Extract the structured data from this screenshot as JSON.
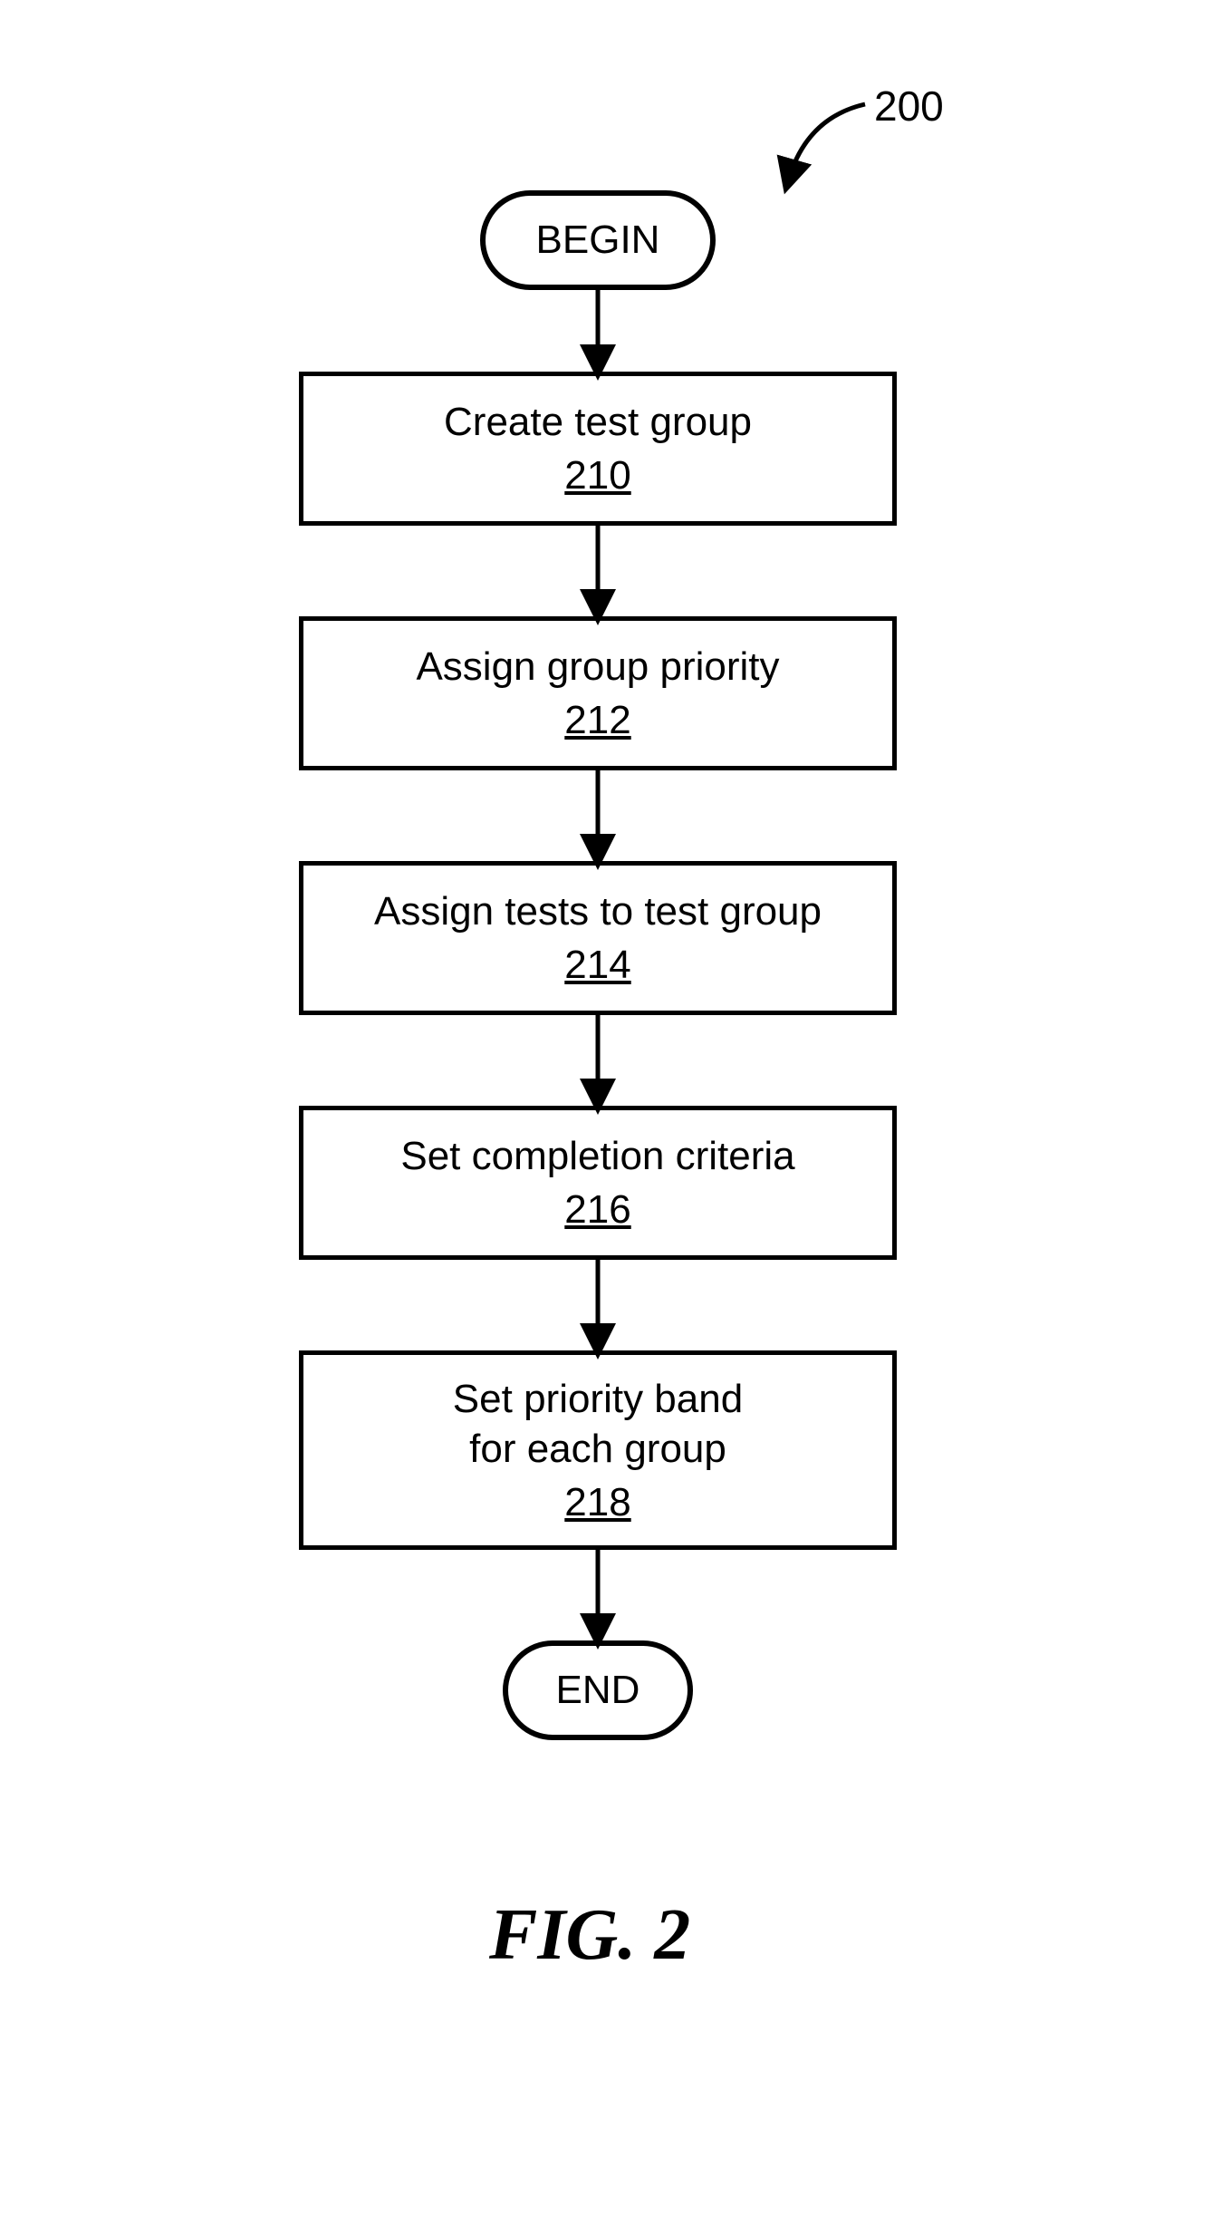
{
  "figure": {
    "overall_ref": "200",
    "caption": "FIG. 2",
    "begin": "BEGIN",
    "end": "END",
    "steps": [
      {
        "text": "Create test group",
        "ref": "210"
      },
      {
        "text": "Assign group priority",
        "ref": "212"
      },
      {
        "text": "Assign tests to test group",
        "ref": "214"
      },
      {
        "text": "Set completion criteria",
        "ref": "216"
      },
      {
        "text_line1": "Set priority band",
        "text_line2": "for each group",
        "ref": "218"
      }
    ]
  }
}
